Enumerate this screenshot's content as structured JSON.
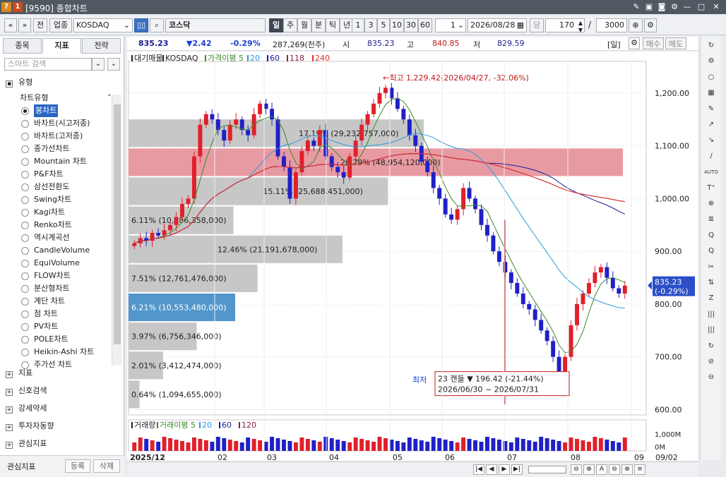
{
  "window": {
    "title": "[9590] 종합차트",
    "icons": [
      "?",
      "1"
    ]
  },
  "toolbar": {
    "left_arrows": [
      "«",
      "»"
    ],
    "jeon_label": "전",
    "market_label": "업종",
    "index_code": "KOSDAQ",
    "index_name_label": "코스닥",
    "period_tabs": [
      "일",
      "주",
      "월",
      "분",
      "틱",
      "년"
    ],
    "minute_options": [
      "1",
      "3",
      "5",
      "10",
      "30",
      "60"
    ],
    "period_count": "1",
    "date": "2026/08/28",
    "dang_label": "당",
    "view_count": "170",
    "total_count": "3000",
    "color_hex_accent": "#3a72c4"
  },
  "left_panel": {
    "tabs": [
      "종목",
      "지표",
      "전략"
    ],
    "active_tab": "지표",
    "search_placeholder": "스마트 검색",
    "section_type_label": "유형",
    "subsection_label": "차트유형",
    "chart_types": [
      "봉차트",
      "바차트(시고저종)",
      "바차트(고저종)",
      "종가선차트",
      "Mountain 차트",
      "P&F차트",
      "삼선전환도",
      "Swing차트",
      "Kagi차트",
      "Renko차트",
      "역시계곡선",
      "CandleVolume",
      "EquiVolume",
      "FLOW차트",
      "분산형차트",
      "계단 차트",
      "점 차트",
      "PV차트",
      "POLE차트",
      "Heikin-Ashi 차트",
      "주가선 차트"
    ],
    "selected_type": "봉차트",
    "sections": [
      "지표",
      "신호검색",
      "강세약세",
      "투자자동향",
      "관심지표"
    ],
    "bottom_label": "관심지표",
    "register_button": "등록",
    "delete_button": "삭제"
  },
  "info_bar": {
    "price": "835.23",
    "change": "▼2.42",
    "change_pct": "-0.29%",
    "volume": "287,269(천주)",
    "open_label": "시",
    "open": "835.23",
    "high_label": "고",
    "high": "840.85",
    "low_label": "저",
    "low": "829.59",
    "period_badge": "[일]",
    "buy_label": "매수",
    "sell_label": "매도"
  },
  "chart_data": {
    "type": "candlestick",
    "legend_items": [
      "대기매물",
      "KOSDAQ",
      "가격이평 5",
      "20",
      "60",
      "118",
      "240"
    ],
    "y_ticks": [
      600,
      700,
      800,
      900,
      1000,
      1100,
      1200
    ],
    "ylim": [
      590,
      1260
    ],
    "x_ticks": [
      "2025/12",
      "02",
      "03",
      "04",
      "05",
      "06",
      "07",
      "08",
      "09",
      "09/02"
    ],
    "current_price_label": [
      "835.23",
      "(-0.29%)"
    ],
    "high_annotation": "←최고 1,229.42(2026/04/27, -32.06%)",
    "low_annotation": {
      "label": "최저",
      "line1": "23 캔들 ▼ 196.42 (-21.44%)",
      "line2": "2026/06/30 ~ 2026/07/31"
    },
    "volume_profile": [
      {
        "lo": 600,
        "hi": 655,
        "pct": "0.64%",
        "vol": "(1,094,655,000)",
        "share": 0.64
      },
      {
        "lo": 655,
        "hi": 710,
        "pct": "2.01%",
        "vol": "(3,412,474,000)",
        "share": 2.01
      },
      {
        "lo": 710,
        "hi": 765,
        "pct": "3.97%",
        "vol": "(6,756,346,000)",
        "share": 3.97
      },
      {
        "lo": 765,
        "hi": 820,
        "pct": "6.21%",
        "vol": "(10,553,480,000)",
        "share": 6.21,
        "current": true
      },
      {
        "lo": 820,
        "hi": 875,
        "pct": "7.51%",
        "vol": "(12,761,476,000)",
        "share": 7.51
      },
      {
        "lo": 875,
        "hi": 930,
        "pct": "12.46%",
        "vol": "(21,191,678,000)",
        "share": 12.46
      },
      {
        "lo": 930,
        "hi": 985,
        "pct": "6.11%",
        "vol": "(10,386,358,000)",
        "share": 6.11
      },
      {
        "lo": 985,
        "hi": 1040,
        "pct": "15.11%",
        "vol": "(25,688,451,000)",
        "share": 15.11
      },
      {
        "lo": 1040,
        "hi": 1095,
        "pct": "28.79%",
        "vol": "(48,954,120,000)",
        "share": 28.79,
        "max": true
      },
      {
        "lo": 1095,
        "hi": 1150,
        "pct": "17.19%",
        "vol": "(29,232,757,000)",
        "share": 17.19
      }
    ],
    "series": [
      {
        "name": "KOSDAQ",
        "color": "#e0202a",
        "close": [
          915,
          925,
          920,
          935,
          930,
          940,
          950,
          965,
          990,
          1000,
          1080,
          1140,
          1160,
          1150,
          1130,
          1110,
          1140,
          1150,
          1130,
          1120,
          1160,
          1180,
          1170,
          1150,
          1080,
          1060,
          1000,
          1050,
          1090,
          1110,
          1100,
          1130,
          1080,
          1060,
          1050,
          1040,
          1080,
          1110,
          1140,
          1160,
          1180,
          1200,
          1210,
          1190,
          1170,
          1150,
          1120,
          1100,
          1070,
          1050,
          1020,
          1000,
          970,
          960,
          980,
          1020,
          1000,
          980,
          950,
          930,
          900,
          880,
          860,
          840,
          820,
          800,
          790,
          770,
          750,
          730,
          700,
          660,
          700,
          760,
          800,
          820,
          840,
          860,
          870,
          850,
          830,
          820,
          835
        ]
      },
      {
        "name": "가격이평 5",
        "color": "#3a8a2a"
      },
      {
        "name": "20",
        "color": "#2a9adf"
      },
      {
        "name": "60",
        "color": "#1a1a9a"
      },
      {
        "name": "118",
        "color": "#8a2040"
      },
      {
        "name": "240",
        "color": "#e03030"
      }
    ],
    "volume_pane": {
      "legend_items": [
        "거래량",
        "거래이평 5",
        "20",
        "60",
        "120"
      ],
      "y_ticks": [
        "1,000M",
        "0M"
      ]
    }
  },
  "status_bar": {
    "buttons": [
      "|◀",
      "◀",
      "▶",
      "▶|",
      "⊖",
      "⊕",
      "A",
      "⊖",
      "⊕",
      "≡"
    ]
  },
  "right_tools": [
    "↻",
    "⚙",
    "○",
    "▦",
    "✎",
    "↗",
    "↘",
    "∕",
    "AUTO",
    "T⁺",
    "⊕",
    "≣",
    "Q",
    "Q",
    "✂",
    "⇅",
    "Z",
    "|||",
    "|||",
    "↻",
    "⊘",
    "⊖"
  ]
}
